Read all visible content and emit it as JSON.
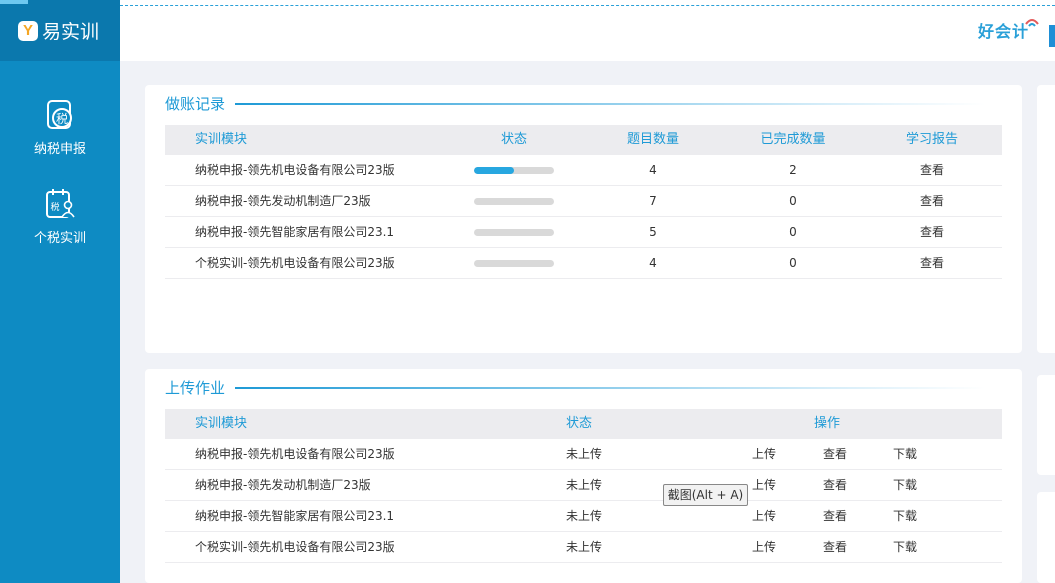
{
  "app": {
    "logo_mark": "Y",
    "name": "易实训"
  },
  "sidebar": {
    "items": [
      {
        "label": "纳税申报",
        "icon": "tax-declaration-icon",
        "icon_glyph": "税"
      },
      {
        "label": "个税实训",
        "icon": "personal-tax-icon",
        "icon_glyph": "税"
      }
    ]
  },
  "header": {
    "brand": "好会计"
  },
  "records": {
    "title": "做账记录",
    "columns": [
      "实训模块",
      "状态",
      "题目数量",
      "已完成数量",
      "学习报告"
    ],
    "rows": [
      {
        "module": "纳税申报-领先机电设备有限公司23版",
        "progress": 0.5,
        "count": "4",
        "done": "2",
        "report": "查看"
      },
      {
        "module": "纳税申报-领先发动机制造厂23版",
        "progress": 0,
        "count": "7",
        "done": "0",
        "report": "查看"
      },
      {
        "module": "纳税申报-领先智能家居有限公司23.1",
        "progress": 0,
        "count": "5",
        "done": "0",
        "report": "查看"
      },
      {
        "module": "个税实训-领先机电设备有限公司23版",
        "progress": 0,
        "count": "4",
        "done": "0",
        "report": "查看"
      }
    ]
  },
  "uploads": {
    "title": "上传作业",
    "columns": [
      "实训模块",
      "状态",
      "操作"
    ],
    "rows": [
      {
        "module": "纳税申报-领先机电设备有限公司23版",
        "status": "未上传",
        "upload": "上传",
        "view": "查看",
        "download": "下载"
      },
      {
        "module": "纳税申报-领先发动机制造厂23版",
        "status": "未上传",
        "upload": "上传",
        "view": "查看",
        "download": "下载"
      },
      {
        "module": "纳税申报-领先智能家居有限公司23.1",
        "status": "未上传",
        "upload": "上传",
        "view": "查看",
        "download": "下载"
      },
      {
        "module": "个税实训-领先机电设备有限公司23版",
        "status": "未上传",
        "upload": "上传",
        "view": "查看",
        "download": "下载"
      }
    ]
  },
  "tooltip": {
    "text": "截图(Alt + A)"
  },
  "colors": {
    "sidebar": "#0e8bc3",
    "accent": "#1e9ad6",
    "progress": "#27a7e0"
  }
}
